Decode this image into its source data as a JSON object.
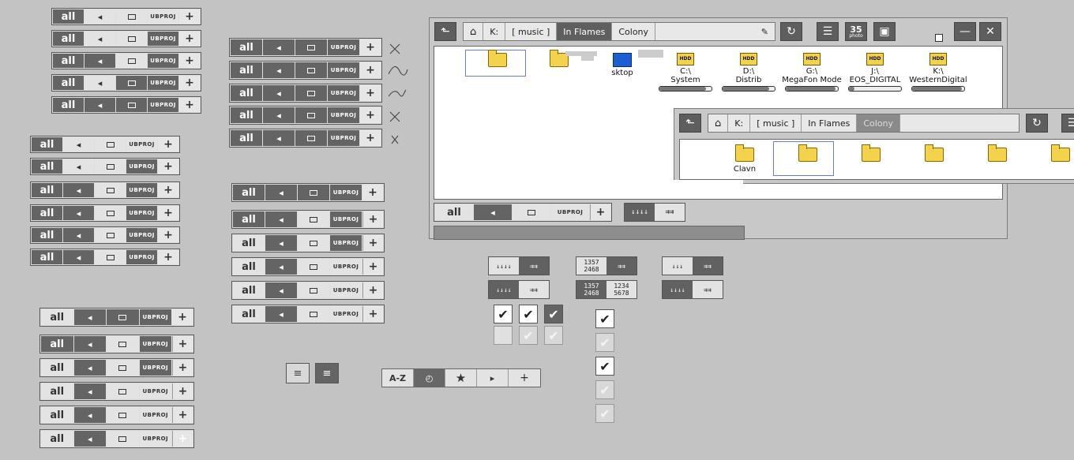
{
  "filter": {
    "all_label": "all",
    "tag_label": "UBPROJ",
    "plus": "+"
  },
  "file_manager": {
    "path_crumbs": [
      "K:",
      "[ music ]",
      "In Flames",
      "Colony"
    ],
    "inner_crumbs": [
      "K:",
      "[ music ]",
      "In Flames",
      "Colony"
    ],
    "items": [
      {
        "name": "",
        "type": "folder"
      },
      {
        "name": "",
        "type": "folder"
      },
      {
        "name": "sktop",
        "type": "desktop"
      },
      {
        "name": "C:\\\nSystem",
        "type": "drive",
        "usage": 0.9
      },
      {
        "name": "D:\\\nDistrib",
        "type": "drive",
        "usage": 0.9
      },
      {
        "name": "G:\\\nMegaFon Mode",
        "type": "drive",
        "usage": 0.95
      },
      {
        "name": "J:\\\nEOS_DIGITAL",
        "type": "drive",
        "usage": 0.1
      },
      {
        "name": "K:\\\nWesternDigital",
        "type": "drive",
        "usage": 0.95
      }
    ],
    "inner_first_name": "Clavn",
    "photo_count": "35",
    "photo_label": "photo",
    "drive_badge": "HDD"
  },
  "toggles": {
    "num_a": "1357\n2468",
    "num_b": "1234\n5678"
  },
  "sort": {
    "az": "A-Z"
  },
  "colors": {
    "bg": "#c3c3c3",
    "dark": "#646464",
    "light": "#e3e3e3",
    "folder": "#f3d24c"
  }
}
